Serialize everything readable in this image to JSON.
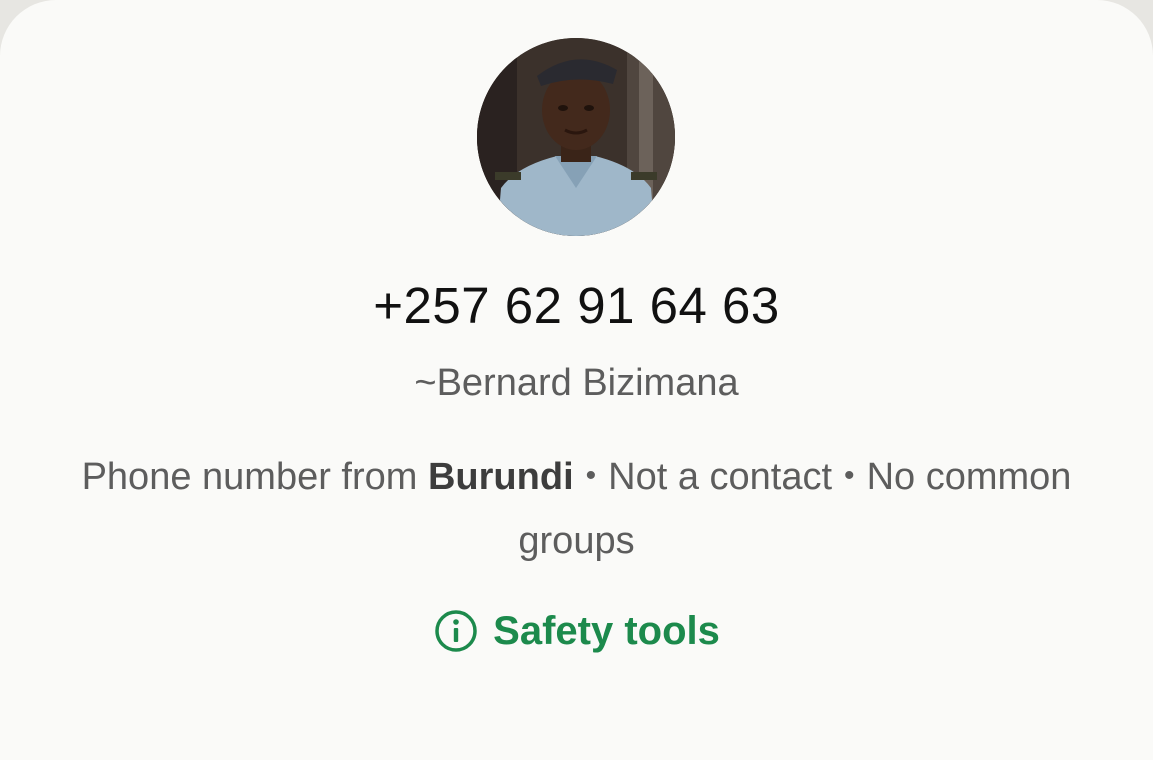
{
  "contact": {
    "phone": "+257 62 91 64 63",
    "push_name": "~Bernard Bizimana",
    "info_prefix": "Phone number from",
    "country": "Burundi",
    "status_1": "Not a contact",
    "status_2": "No common groups"
  },
  "actions": {
    "safety_label": "Safety tools",
    "safety_icon": "info-circle-icon",
    "accent_color": "#1c8a4c"
  },
  "avatar": {
    "icon": "profile-photo"
  }
}
